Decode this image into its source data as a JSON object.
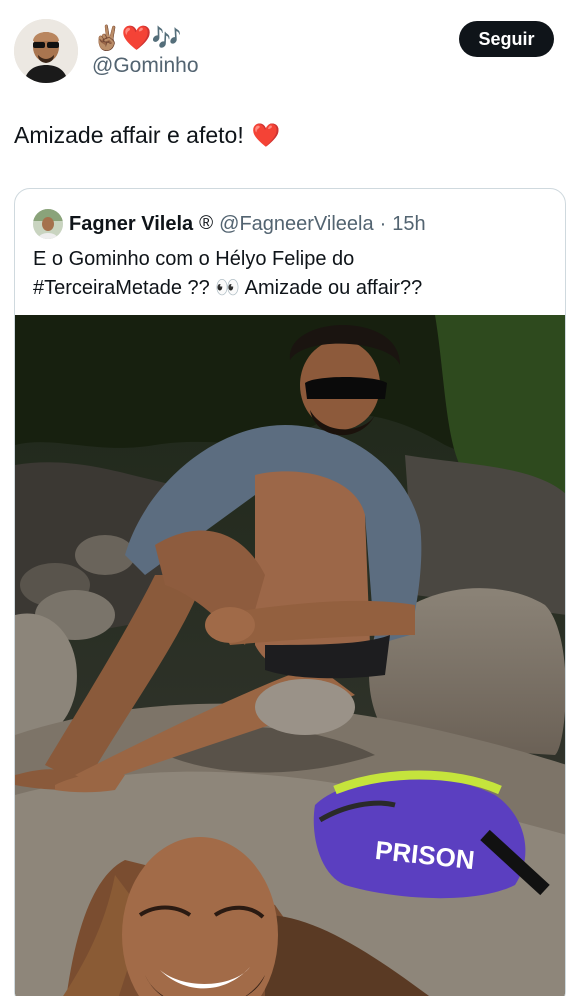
{
  "post": {
    "display_name_emojis": "✌🏽❤️🎶",
    "handle": "@Gominho",
    "follow_label": "Seguir",
    "text": "Amizade affair e afeto!",
    "text_emoji": "❤️"
  },
  "quoted": {
    "name": "Fagner Vilela",
    "badge": "®",
    "handle": "@FagneerVileela",
    "separator": "·",
    "time": "15h",
    "text_line1": "E o Gominho com o Hélyo Felipe do",
    "text_line2": "#TerceiraMetade ?? 👀 Amizade ou affair??",
    "bag_text": "PRISON"
  },
  "colors": {
    "text_primary": "#0f1419",
    "text_secondary": "#536471",
    "border": "#cfd9de",
    "button_bg": "#0f1419",
    "heart": "#f4212e"
  }
}
